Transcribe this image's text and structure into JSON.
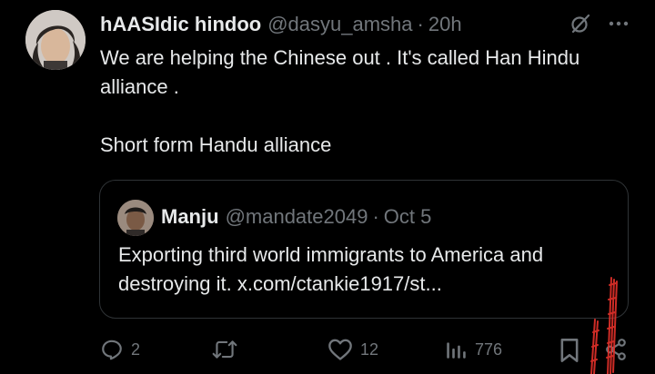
{
  "post": {
    "display_name": "hAASIdic hindoo",
    "handle": "@dasyu_amsha",
    "separator": "·",
    "time": "20h",
    "text_line1": "We are helping the Chinese out . It's called Han Hindu alliance .",
    "text_line2": "Short form Handu alliance"
  },
  "quote": {
    "display_name": "Manju",
    "handle": "@mandate2049",
    "separator": "·",
    "date": "Oct 5",
    "text": "Exporting third world immigrants to America and destroying it. x.com/ctankie1917/st..."
  },
  "actions": {
    "replies": "2",
    "retweets": "",
    "likes": "12",
    "views": "776"
  },
  "icons": {
    "grok": "grok-slash-icon",
    "more": "more-dots-icon",
    "reply": "reply-icon",
    "retweet": "retweet-icon",
    "like": "heart-icon",
    "views": "views-bar-icon",
    "bookmark": "bookmark-icon",
    "share": "share-icon"
  },
  "colors": {
    "background": "#000000",
    "text": "#e7e9ea",
    "muted": "#71767b",
    "border": "#2f3336",
    "scribble": "#e0302a"
  }
}
